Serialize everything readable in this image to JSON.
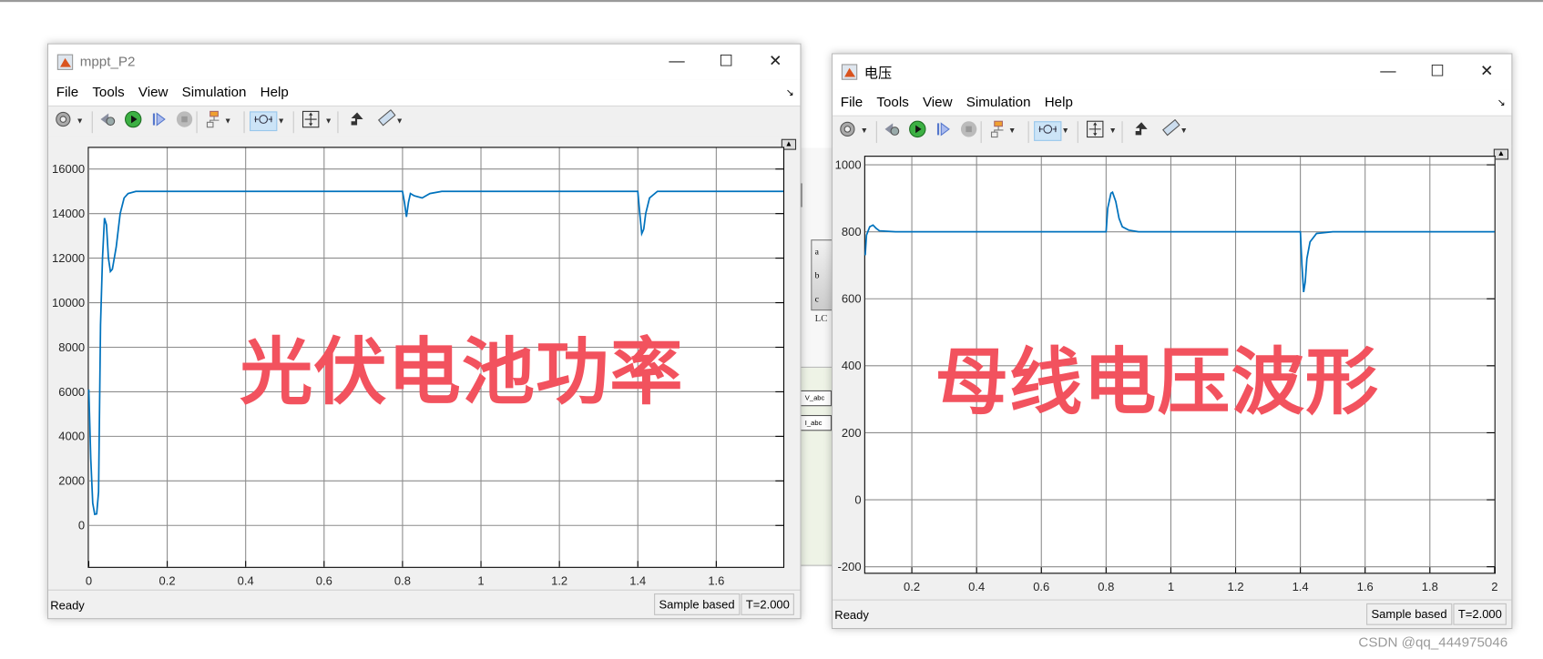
{
  "background_model": {
    "ports": [
      "a",
      "b",
      "c"
    ],
    "block_label": "LC",
    "tags": [
      "V_abc",
      "I_abc"
    ],
    "region_color": "#eef3e6"
  },
  "windows": [
    {
      "title": "mppt_P2",
      "menu": [
        "File",
        "Tools",
        "View",
        "Simulation",
        "Help"
      ],
      "window_buttons": {
        "minimize": "—",
        "maximize": "☐",
        "close": "✕"
      },
      "toolbar_icons": [
        "gear-icon",
        "camera-step-back-icon",
        "run-icon",
        "step-forward-icon",
        "stop-icon",
        "signal-routing-icon",
        "zoom-mode-icon",
        "autoscale-icon",
        "highlight-block-icon",
        "ruler-icon"
      ],
      "status": {
        "left": "Ready",
        "mode": "Sample based",
        "time": "T=2.000"
      },
      "watermark": "光伏电池功率",
      "chart_data": {
        "type": "line",
        "title": "",
        "xlabel": "",
        "ylabel": "",
        "xlim": [
          0,
          1.771
        ],
        "ylim": [
          -1860,
          16950
        ],
        "xticks": [
          0,
          0.2,
          0.4,
          0.6,
          0.8,
          1,
          1.2,
          1.4,
          1.6
        ],
        "xtick_labels": [
          "0",
          "0.2",
          "0.4",
          "0.6",
          "0.8",
          "1",
          "1.2",
          "1.4",
          "1.6"
        ],
        "yticks": [
          0,
          2000,
          4000,
          6000,
          8000,
          10000,
          12000,
          14000,
          16000
        ],
        "ytick_labels": [
          "0",
          "2000",
          "4000",
          "6000",
          "8000",
          "10000",
          "12000",
          "14000",
          "16000"
        ],
        "grid": true,
        "line_color": "#0072bd",
        "series": [
          {
            "x": [
              0,
              0.005,
              0.01,
              0.015,
              0.02,
              0.025,
              0.03,
              0.035,
              0.04,
              0.045,
              0.05,
              0.055,
              0.06,
              0.07,
              0.08,
              0.09,
              0.1,
              0.12,
              0.8,
              0.805,
              0.81,
              0.815,
              0.82,
              0.83,
              0.85,
              0.87,
              0.9,
              1.4,
              1.405,
              1.41,
              1.415,
              1.42,
              1.43,
              1.45,
              1.771
            ],
            "y": [
              6100,
              3000,
              1000,
              500,
              520,
              1500,
              9000,
              12000,
              13800,
              13500,
              12000,
              11400,
              11500,
              12500,
              14000,
              14700,
              14900,
              15000,
              15000,
              14500,
              13850,
              14500,
              14900,
              14800,
              14700,
              14900,
              15000,
              15000,
              14000,
              13100,
              13300,
              14000,
              14700,
              15000,
              15000
            ]
          }
        ]
      }
    },
    {
      "title": "电压",
      "menu": [
        "File",
        "Tools",
        "View",
        "Simulation",
        "Help"
      ],
      "window_buttons": {
        "minimize": "—",
        "maximize": "☐",
        "close": "✕"
      },
      "toolbar_icons": [
        "gear-icon",
        "camera-step-back-icon",
        "run-icon",
        "step-forward-icon",
        "stop-icon",
        "signal-routing-icon",
        "zoom-mode-icon",
        "autoscale-icon",
        "highlight-block-icon",
        "ruler-icon"
      ],
      "status": {
        "left": "Ready",
        "mode": "Sample based",
        "time": "T=2.000"
      },
      "watermark": "母线电压波形",
      "chart_data": {
        "type": "line",
        "title": "",
        "xlabel": "",
        "ylabel": "",
        "xlim": [
          0.056,
          2
        ],
        "ylim": [
          -218,
          1024
        ],
        "xticks": [
          0.2,
          0.4,
          0.6,
          0.8,
          1,
          1.2,
          1.4,
          1.6,
          1.8,
          2
        ],
        "xtick_labels": [
          "0.2",
          "0.4",
          "0.6",
          "0.8",
          "1",
          "1.2",
          "1.4",
          "1.6",
          "1.8",
          "2"
        ],
        "yticks": [
          -200,
          0,
          200,
          400,
          600,
          800,
          1000
        ],
        "ytick_labels": [
          "-200",
          "0",
          "200",
          "400",
          "600",
          "800",
          "1000"
        ],
        "grid": true,
        "line_color": "#0072bd",
        "series": [
          {
            "x": [
              0.056,
              0.06,
              0.07,
              0.08,
              0.09,
              0.1,
              0.15,
              0.8,
              0.805,
              0.815,
              0.82,
              0.83,
              0.84,
              0.85,
              0.87,
              0.9,
              1.4,
              1.405,
              1.41,
              1.415,
              1.42,
              1.43,
              1.45,
              1.5,
              2
            ],
            "y": [
              730,
              790,
              815,
              820,
              810,
              803,
              800,
              800,
              870,
              915,
              918,
              890,
              840,
              815,
              805,
              800,
              800,
              700,
              620,
              650,
              720,
              770,
              795,
              800,
              800
            ]
          }
        ]
      }
    }
  ],
  "footer_watermark": "CSDN @qq_444975046"
}
